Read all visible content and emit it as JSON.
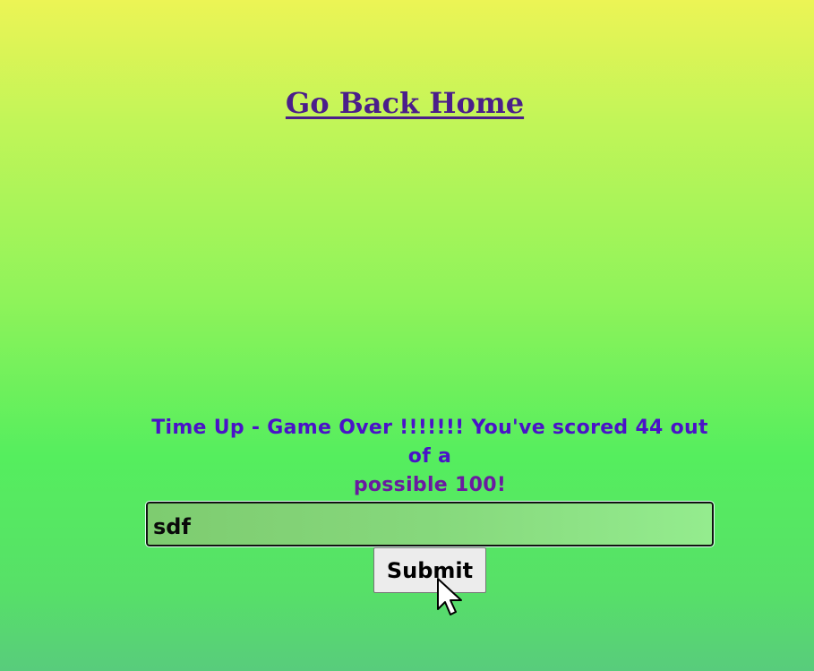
{
  "nav": {
    "home_link": "Go Back Home"
  },
  "result": {
    "line1": "Time Up - Game Over !!!!!!! You've scored 44 out of a",
    "line2": "possible 100!"
  },
  "form": {
    "input_value": "sdf",
    "submit_label": "Submit"
  },
  "icons": {
    "pointer": "mouse-pointer-icon"
  },
  "colors": {
    "link": "#4b1e8a",
    "result_text": "#4a12c8",
    "background_top": "#ecf455",
    "background_bottom": "#58cc7c"
  }
}
